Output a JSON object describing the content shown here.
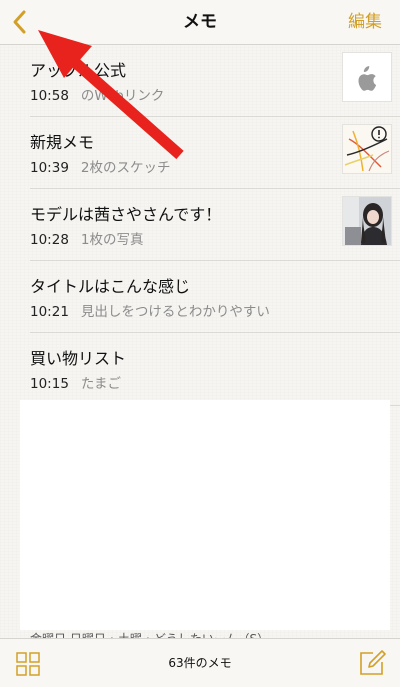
{
  "nav": {
    "title": "メモ",
    "edit_label": "編集",
    "back_icon": "chevron-left-icon",
    "accent_color": "#d2a028"
  },
  "notes": [
    {
      "title": "アップル公式",
      "time": "10:58",
      "preview": "のWebリンク",
      "thumbnail": "apple-logo"
    },
    {
      "title": "新規メモ",
      "time": "10:39",
      "preview": "2枚のスケッチ",
      "thumbnail": "sketch"
    },
    {
      "title": "モデルは茜さやさんです！",
      "time": "10:28",
      "preview": "1枚の写真",
      "thumbnail": "photo"
    },
    {
      "title": "タイトルはこんな感じ",
      "time": "10:21",
      "preview": "見出しをつけるとわかりやすい",
      "thumbnail": ""
    },
    {
      "title": "買い物リスト",
      "time": "10:15",
      "preview": "たまご",
      "thumbnail": ""
    }
  ],
  "preview_cut_text": "金曜日 日曜日・土曜・どうしたいーム（S）",
  "toolbar": {
    "count_label": "63件のメモ",
    "grid_icon": "grid-icon",
    "compose_icon": "compose-icon"
  },
  "annotation": {
    "type": "arrow",
    "color": "#e8221c"
  }
}
